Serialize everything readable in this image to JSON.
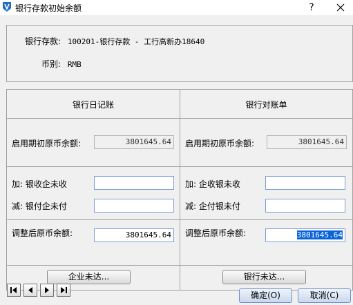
{
  "window": {
    "title": "银行存款初始余额",
    "help_label": "?",
    "close_icon": "close-icon",
    "app_icon": "app-logo-icon"
  },
  "info": {
    "account_label": "银行存款:",
    "account_value": "100201-银行存款 - 工行高新办18640",
    "currency_label": "币别:",
    "currency_value": "RMB"
  },
  "journal": {
    "header": "银行日记账",
    "opening_label": "启用期初原币余额:",
    "opening_value": "3801645.64",
    "add_label": "加: 银收企未收",
    "add_value": "",
    "sub_label": "减: 银付企未付",
    "sub_value": "",
    "adjusted_label": "调整后原币余额:",
    "adjusted_value": "3801645.64",
    "button_label": "企业未达..."
  },
  "statement": {
    "header": "银行对账单",
    "opening_label": "启用期初原币余额:",
    "opening_value": "3801645.64",
    "add_label": "加: 企收银未收",
    "add_value": "",
    "sub_label": "减: 企付银未付",
    "sub_value": "",
    "adjusted_label": "调整后原币余额:",
    "adjusted_value": "3801645.64",
    "button_label": "银行未达..."
  },
  "footer": {
    "nav_icons": [
      "first-record-icon",
      "previous-record-icon",
      "next-record-icon",
      "last-record-icon"
    ],
    "ok_label": "确定(O)",
    "cancel_label": "取消(C)"
  },
  "colors": {
    "selection": "#0a64d8",
    "field_border": "#7a9cd3",
    "dialog_background": "#f0f0f0"
  }
}
